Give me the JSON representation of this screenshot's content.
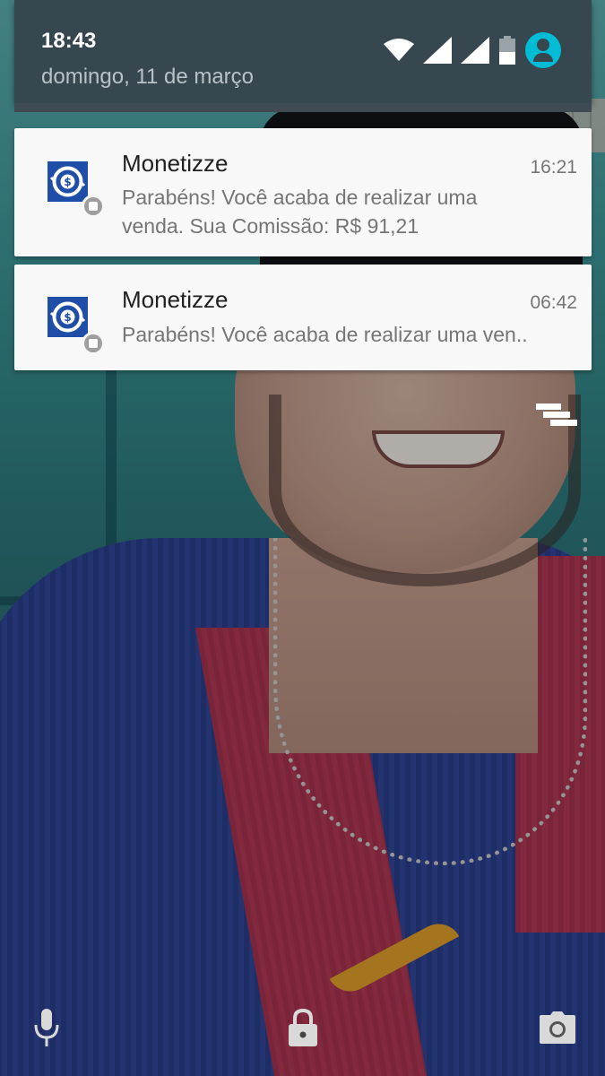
{
  "status_bar": {
    "time": "18:43",
    "date": "domingo, 11 de março",
    "icons": [
      "wifi-icon",
      "signal-icon",
      "signal-icon",
      "battery-icon",
      "user-avatar-icon"
    ],
    "avatar_color": "#00bcd4"
  },
  "notifications": [
    {
      "app": "Monetizze",
      "time": "16:21",
      "line1": "Parabéns! Você acaba de realizar uma",
      "line2": "venda. Sua Comissão: R$ 91,21"
    },
    {
      "app": "Monetizze",
      "time": "06:42",
      "line1": "Parabéns! Você acaba de realizar uma ven.."
    }
  ],
  "lockscreen": {
    "shortcuts": [
      "microphone-icon",
      "lock-icon",
      "camera-icon"
    ]
  },
  "colors": {
    "header_bg": "#37474f",
    "card_bg": "#f8f8f8",
    "app_icon_bg": "#1e4ea8"
  }
}
